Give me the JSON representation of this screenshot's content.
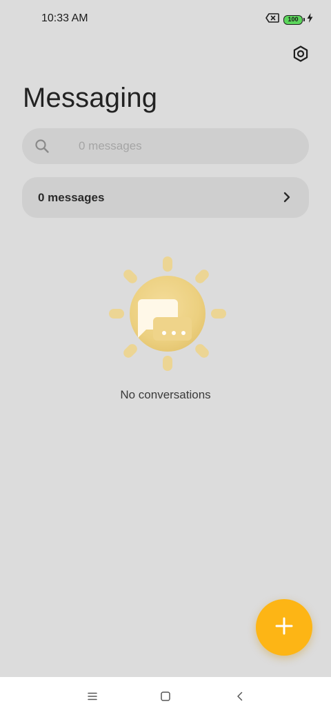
{
  "status_bar": {
    "time": "10:33 AM",
    "battery_level": "100",
    "icons": [
      "no-sim-icon",
      "battery-icon",
      "charging-icon"
    ]
  },
  "header": {
    "title": "Messaging",
    "settings_icon": "settings-icon"
  },
  "search": {
    "placeholder": "0 messages",
    "icon": "search-icon"
  },
  "summary": {
    "label": "0 messages",
    "icon": "chevron-right-icon"
  },
  "empty_state": {
    "illustration": "sun-chat-illustration",
    "text": "No conversations"
  },
  "fab": {
    "icon": "plus-icon",
    "color": "#fdb515"
  },
  "nav_bar": {
    "buttons": [
      "menu-icon",
      "home-icon",
      "back-icon"
    ]
  },
  "colors": {
    "background": "#dcdcdc",
    "card": "#cfcfcf",
    "accent": "#fdb515",
    "battery": "#5cd65c"
  }
}
